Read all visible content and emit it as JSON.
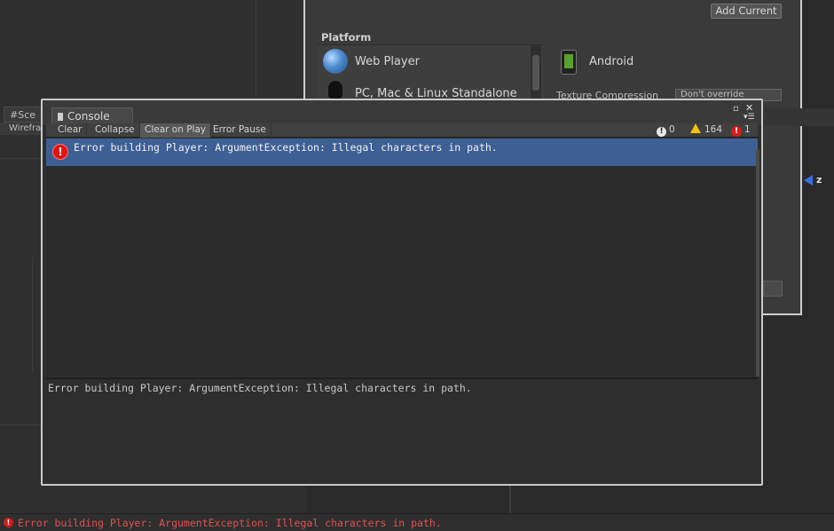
{
  "background": {
    "scene_tab": "Sce",
    "scene_subtab": "Wirefra",
    "build_settings": {
      "add_current_label": "Add Current",
      "platform_header": "Platform",
      "platforms": [
        {
          "label": "Web Player",
          "icon": "globe-icon"
        },
        {
          "label": "PC, Mac & Linux Standalone",
          "icon": "tux-icon"
        }
      ],
      "selected_platform": "Android",
      "texture_compression_label": "Texture Compression",
      "texture_compression_value": "Don't override"
    },
    "axis_label": "z"
  },
  "console": {
    "title": "Console",
    "toolbar": {
      "buttons": [
        "Clear",
        "Collapse",
        "Clear on Play",
        "Error Pause"
      ],
      "active_button": "Clear on Play",
      "info_count": "0",
      "warning_count": "164",
      "error_count": "1"
    },
    "log_entries": [
      {
        "type": "error",
        "text": "Error building Player: ArgumentException: Illegal characters in path.",
        "selected": true
      }
    ],
    "detail_text": "Error building Player: ArgumentException: Illegal characters in path."
  },
  "status_bar": {
    "text": "Error building Player: ArgumentException: Illegal characters in path."
  },
  "colors": {
    "selection": "#3d5f94",
    "error_red": "#d21b1b",
    "warning_yellow": "#f3c20e",
    "status_error_text": "#e05050"
  }
}
